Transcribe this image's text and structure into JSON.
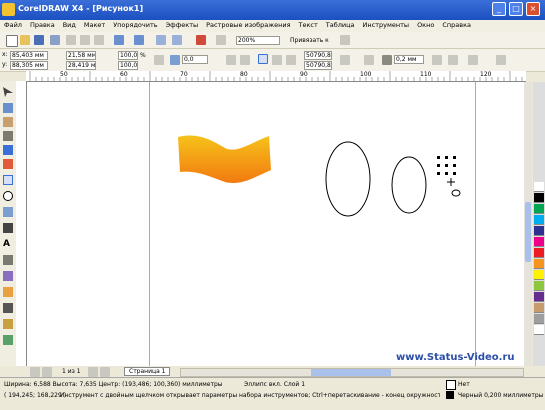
{
  "window": {
    "title": "CorelDRAW X4 - [Рисунок1]",
    "buttons": [
      "_",
      "□",
      "×"
    ]
  },
  "menu": {
    "items": [
      "Файл",
      "Правка",
      "Вид",
      "Макет",
      "Упорядочить",
      "Эффекты",
      "Растровые изображения",
      "Текст",
      "Таблица",
      "Инструменты",
      "Окно",
      "Справка"
    ]
  },
  "toolbar": {
    "zoom": "200%",
    "snap_label": "Привязать к"
  },
  "propbar": {
    "x": "85,403 мм",
    "y": "88,305 мм",
    "width": "21,58 мм",
    "height": "28,419 мм",
    "scale_w": "100,0",
    "scale_h": "100,0",
    "unit": "%",
    "angle": "0,0",
    "node_x": "50790,8",
    "node_y": "50790,8",
    "outline": "0,2 мм"
  },
  "ruler": {
    "ticks": [
      "50",
      "60",
      "70",
      "80",
      "90",
      "100",
      "110",
      "120"
    ]
  },
  "pages": {
    "counter": "1 из 1",
    "tab": "Страница 1"
  },
  "status": {
    "line1": "Ширина: 6,588  Высота: 7,635  Центр: (193,486; 100,360) миллиметры",
    "object": "Эллипс вкл. Слой 1",
    "coords": "( 194,245; 168,229 )",
    "hint": "Инструмент с двойным щелчком открывает параметры набора инструментов; Ctrl+перетаскивание - конец окружности; Shift+перет...",
    "fill": "Нет",
    "outline": "Черный 0,200 миллиметры"
  },
  "watermark": "www.Status-Video.ru",
  "colors": {
    "titlebar": "#2a5fd0",
    "gradient_top": "#f6c21a",
    "gradient_bottom": "#f27a10",
    "swatches": [
      "#ffffff",
      "#000000",
      "#00a651",
      "#00aeef",
      "#2e3192",
      "#ec008c",
      "#ed1c24",
      "#f7941d",
      "#fff200",
      "#8dc63f",
      "#662d91",
      "#c69c6d",
      "#9e9e9e",
      "#ffffff"
    ]
  }
}
